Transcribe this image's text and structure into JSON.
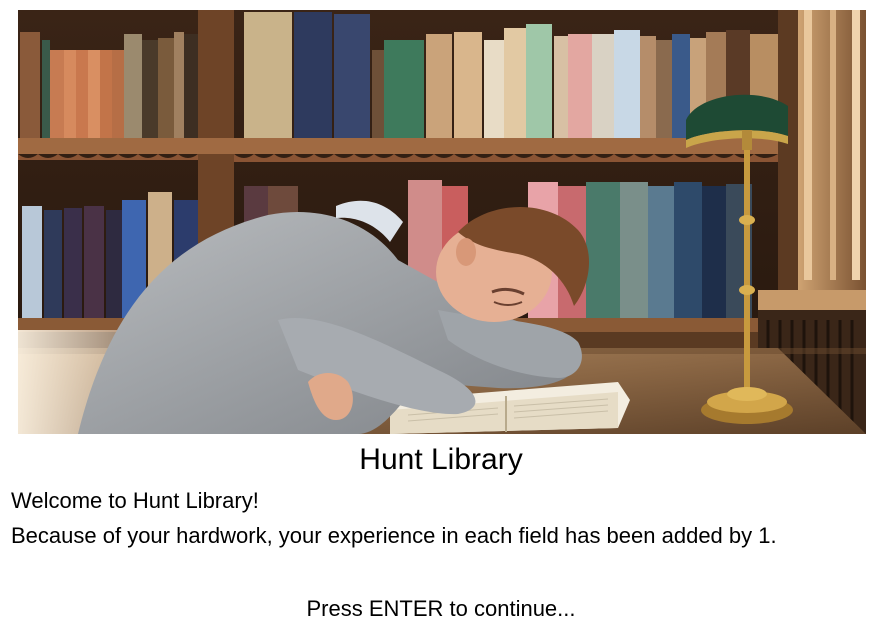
{
  "location": {
    "name": "Hunt Library",
    "image": "student sleeping on a book in a library"
  },
  "message": {
    "welcome": "Welcome to Hunt Library!",
    "reward": "Because of your hardwork, your experience in each field has been added by 1."
  },
  "prompt": "Press ENTER to continue..."
}
